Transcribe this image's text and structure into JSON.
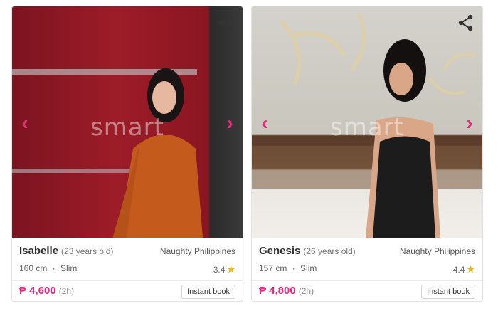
{
  "colors": {
    "accent": "#e8287a",
    "star": "#f5b400"
  },
  "watermark": "smart",
  "cards": [
    {
      "name": "Isabelle",
      "age": "(23 years old)",
      "agency": "Naughty Philippines",
      "height": "160 cm",
      "separator": "·",
      "body_type": "Slim",
      "rating": "3.4",
      "price": "₱ 4,600",
      "duration": "(2h)",
      "book_label": "Instant book"
    },
    {
      "name": "Genesis",
      "age": "(26 years old)",
      "agency": "Naughty Philippines",
      "height": "157 cm",
      "separator": "·",
      "body_type": "Slim",
      "rating": "4.4",
      "price": "₱ 4,800",
      "duration": "(2h)",
      "book_label": "Instant book"
    }
  ],
  "icons": {
    "share": "share-icon",
    "prev": "chevron-left-icon",
    "next": "chevron-right-icon",
    "star": "star-icon"
  }
}
